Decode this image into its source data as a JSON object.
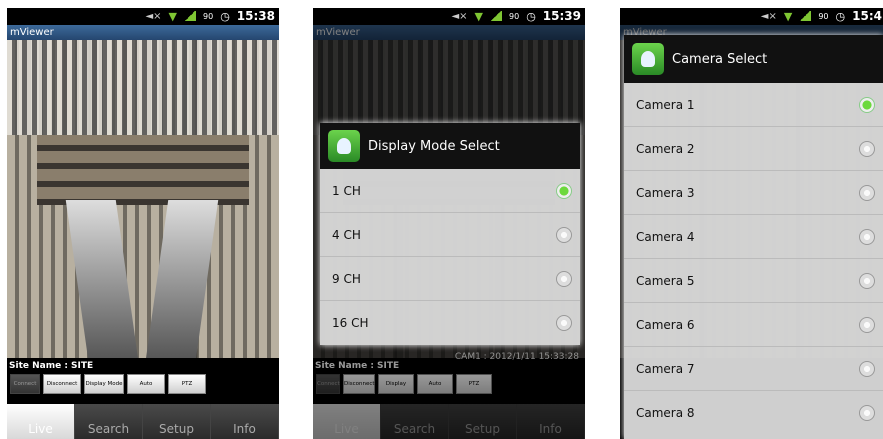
{
  "status": {
    "time1": "15:38",
    "time2": "15:39",
    "time3": "15:4",
    "battery": "90"
  },
  "app_title": "mViewer",
  "site_name": "Site Name : SITE",
  "cam_info": "CAM1 : 2012/1/11 15:33:28",
  "controls": [
    "Connect",
    "Disconnect",
    "Display Mode",
    "Auto",
    "PTZ"
  ],
  "tabs": [
    "Live",
    "Search",
    "Setup",
    "Info"
  ],
  "display_dialog": {
    "title": "Display Mode Select",
    "options": [
      "1 CH",
      "4 CH",
      "9 CH",
      "16 CH"
    ],
    "selected_index": 0
  },
  "camera_dialog": {
    "title": "Camera Select",
    "options": [
      "Camera 1",
      "Camera 2",
      "Camera 3",
      "Camera 4",
      "Camera 5",
      "Camera 6",
      "Camera 7",
      "Camera 8"
    ],
    "selected_index": 0
  },
  "colors": {
    "accent": "#6cd93c",
    "titlebar": "#2f5a8a"
  }
}
